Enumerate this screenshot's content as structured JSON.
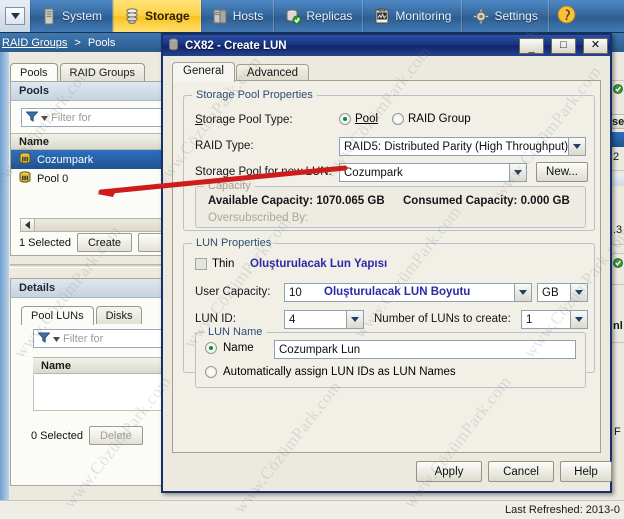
{
  "toolbar": {
    "items": [
      {
        "label": "System",
        "icon": "tower-icon",
        "active": false
      },
      {
        "label": "Storage",
        "icon": "disk-stack-icon",
        "active": true
      },
      {
        "label": "Hosts",
        "icon": "server-icon",
        "active": false
      },
      {
        "label": "Replicas",
        "icon": "replica-icon",
        "active": false
      },
      {
        "label": "Monitoring",
        "icon": "monitor-icon",
        "active": false
      },
      {
        "label": "Settings",
        "icon": "gear-icon",
        "active": false
      }
    ],
    "help_icon": "help-icon",
    "dropdown_icon": "chevron-down-icon"
  },
  "breadcrumb": {
    "first": "RAID Groups",
    "separator": ">",
    "current": "Pools"
  },
  "page": {
    "tabs": [
      {
        "label": "Pools",
        "selected": true
      },
      {
        "label": "RAID Groups",
        "selected": false
      }
    ],
    "pools_panel": {
      "title": "Pools",
      "filter_placeholder": "Filter for",
      "filter_icon": "funnel-icon",
      "column_header": "Name",
      "rows": [
        {
          "name": "Cozumpark",
          "icon": "pool-icon",
          "selected": true
        },
        {
          "name": "Pool 0",
          "icon": "pool-icon",
          "selected": false
        }
      ],
      "selection_text": "1 Selected",
      "create_button": "Create",
      "scroll_left_icon": "chevron-left-icon"
    },
    "details_panel": {
      "title": "Details",
      "tabs": [
        {
          "label": "Pool LUNs",
          "selected": true
        },
        {
          "label": "Disks",
          "selected": false
        }
      ],
      "filter_placeholder": "Filter for",
      "filter_icon": "funnel-icon",
      "column_header": "Name",
      "selection_text": "0 Selected",
      "delete_button": "Delete"
    }
  },
  "background_right": {
    "fragments": [
      "se",
      "2",
      ".3",
      "nl",
      "F"
    ]
  },
  "statusbar": {
    "last_refreshed": "Last Refreshed: 2013-0"
  },
  "dialog": {
    "title": "CX82 - Create LUN",
    "title_icon": "app-icon",
    "window_buttons": {
      "minimize": "_",
      "maximize": "□",
      "close": "✕"
    },
    "tabs": [
      {
        "label": "General",
        "selected": true
      },
      {
        "label": "Advanced",
        "selected": false
      }
    ],
    "storage_pool_properties": {
      "legend": "Storage Pool Properties",
      "pool_type_label": "Storage Pool Type:",
      "pool_radio_label": "Pool",
      "raid_group_radio_label": "RAID Group",
      "pool_radio_selected": true,
      "raid_type_label": "RAID Type:",
      "raid_type_value": "RAID5: Distributed Parity (High Throughput)",
      "storage_pool_label": "Storage Pool for new LUN:",
      "storage_pool_value": "Cozumpark",
      "new_button": "New...",
      "capacity_legend": "Capacity",
      "available_capacity": "Available Capacity: 1070.065 GB",
      "consumed_capacity": "Consumed Capacity: 0.000 GB",
      "oversubscribed": "Oversubscribed By:"
    },
    "lun_properties": {
      "legend": "LUN Properties",
      "thin_label": "Thin",
      "thin_checked": false,
      "thin_annotation": "Oluşturulacak Lun Yapısı",
      "user_capacity_label": "User Capacity:",
      "user_capacity_value": "10",
      "user_capacity_annotation": "Oluşturulacak LUN Boyutu",
      "capacity_unit": "GB",
      "lun_id_label": "LUN ID:",
      "lun_id_value": "4",
      "number_of_luns_label": "Number of LUNs to create:",
      "number_of_luns_value": "1"
    },
    "lun_name": {
      "legend": "LUN Name",
      "name_radio_label": "Name",
      "name_radio_selected": true,
      "name_value": "Cozumpark Lun",
      "auto_radio_label": "Automatically assign LUN IDs as LUN Names",
      "auto_radio_selected": false
    },
    "footer": {
      "apply": "Apply",
      "cancel": "Cancel",
      "help": "Help"
    }
  },
  "watermark": {
    "text": "www.CözümPark.com"
  },
  "colors": {
    "accent_blue": "#2c5a8c",
    "active_tab_yellow": "#fdd23e",
    "dialog_title_blue": "#18307e",
    "selection_blue": "#2f6fbe",
    "annotation_blue": "#2a2aa8",
    "arrow_red": "#d01b1b"
  }
}
